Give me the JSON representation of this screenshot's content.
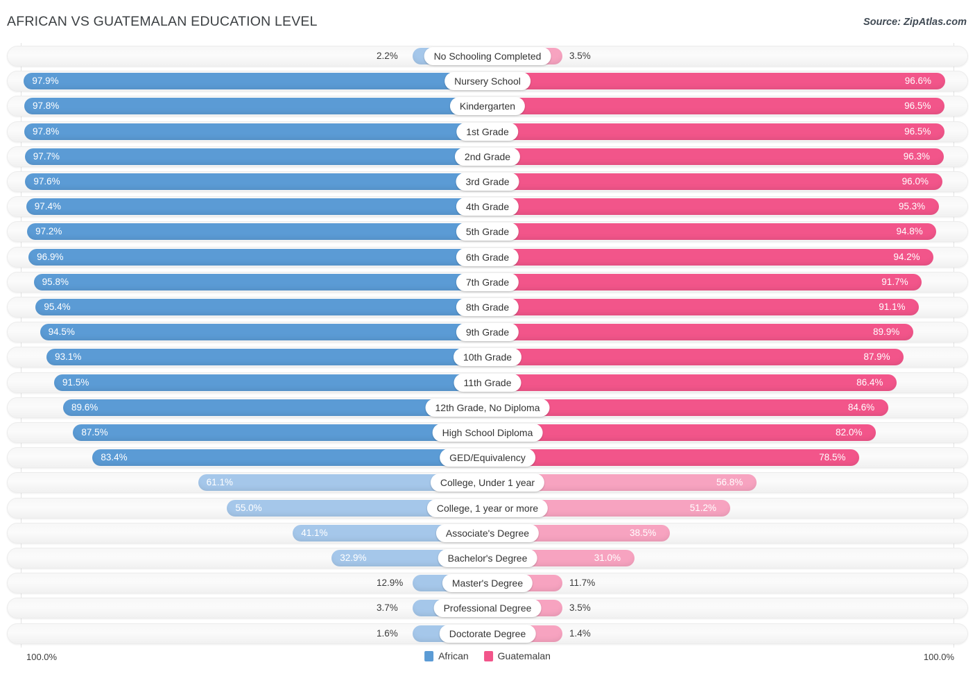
{
  "header": {
    "title": "AFRICAN VS GUATEMALAN EDUCATION LEVEL",
    "source": "Source: ZipAtlas.com"
  },
  "legend": {
    "left_label": "African",
    "right_label": "Guatemalan",
    "left_color": "#5b9bd5",
    "right_color": "#f2558a"
  },
  "footer": {
    "left_value": "100.0%",
    "right_value": "100.0%"
  },
  "chart_data": {
    "type": "bar",
    "orientation": "diverging-horizontal",
    "title": "AFRICAN VS GUATEMALAN EDUCATION LEVEL",
    "xlabel": "",
    "ylabel": "",
    "axis_max": 100.0,
    "grid": false,
    "legend_position": "bottom-center",
    "categories": [
      "No Schooling Completed",
      "Nursery School",
      "Kindergarten",
      "1st Grade",
      "2nd Grade",
      "3rd Grade",
      "4th Grade",
      "5th Grade",
      "6th Grade",
      "7th Grade",
      "8th Grade",
      "9th Grade",
      "10th Grade",
      "11th Grade",
      "12th Grade, No Diploma",
      "High School Diploma",
      "GED/Equivalency",
      "College, Under 1 year",
      "College, 1 year or more",
      "Associate's Degree",
      "Bachelor's Degree",
      "Master's Degree",
      "Professional Degree",
      "Doctorate Degree"
    ],
    "series": [
      {
        "name": "African",
        "side": "left",
        "color": "#5b9bd5",
        "values": [
          2.2,
          97.9,
          97.8,
          97.8,
          97.7,
          97.6,
          97.4,
          97.2,
          96.9,
          95.8,
          95.4,
          94.5,
          93.1,
          91.5,
          89.6,
          87.5,
          83.4,
          61.1,
          55.0,
          41.1,
          32.9,
          12.9,
          3.7,
          1.6
        ],
        "labels": [
          "2.2%",
          "97.9%",
          "97.8%",
          "97.8%",
          "97.7%",
          "97.6%",
          "97.4%",
          "97.2%",
          "96.9%",
          "95.8%",
          "95.4%",
          "94.5%",
          "93.1%",
          "91.5%",
          "89.6%",
          "87.5%",
          "83.4%",
          "61.1%",
          "55.0%",
          "41.1%",
          "32.9%",
          "12.9%",
          "3.7%",
          "1.6%"
        ]
      },
      {
        "name": "Guatemalan",
        "side": "right",
        "color": "#f2558a",
        "values": [
          3.5,
          96.6,
          96.5,
          96.5,
          96.3,
          96.0,
          95.3,
          94.8,
          94.2,
          91.7,
          91.1,
          89.9,
          87.9,
          86.4,
          84.6,
          82.0,
          78.5,
          56.8,
          51.2,
          38.5,
          31.0,
          11.7,
          3.5,
          1.4
        ],
        "labels": [
          "3.5%",
          "96.6%",
          "96.5%",
          "96.5%",
          "96.3%",
          "96.0%",
          "95.3%",
          "94.8%",
          "94.2%",
          "91.7%",
          "91.1%",
          "89.9%",
          "87.9%",
          "86.4%",
          "84.6%",
          "82.0%",
          "78.5%",
          "56.8%",
          "51.2%",
          "38.5%",
          "31.0%",
          "11.7%",
          "3.5%",
          "1.4%"
        ]
      }
    ]
  }
}
